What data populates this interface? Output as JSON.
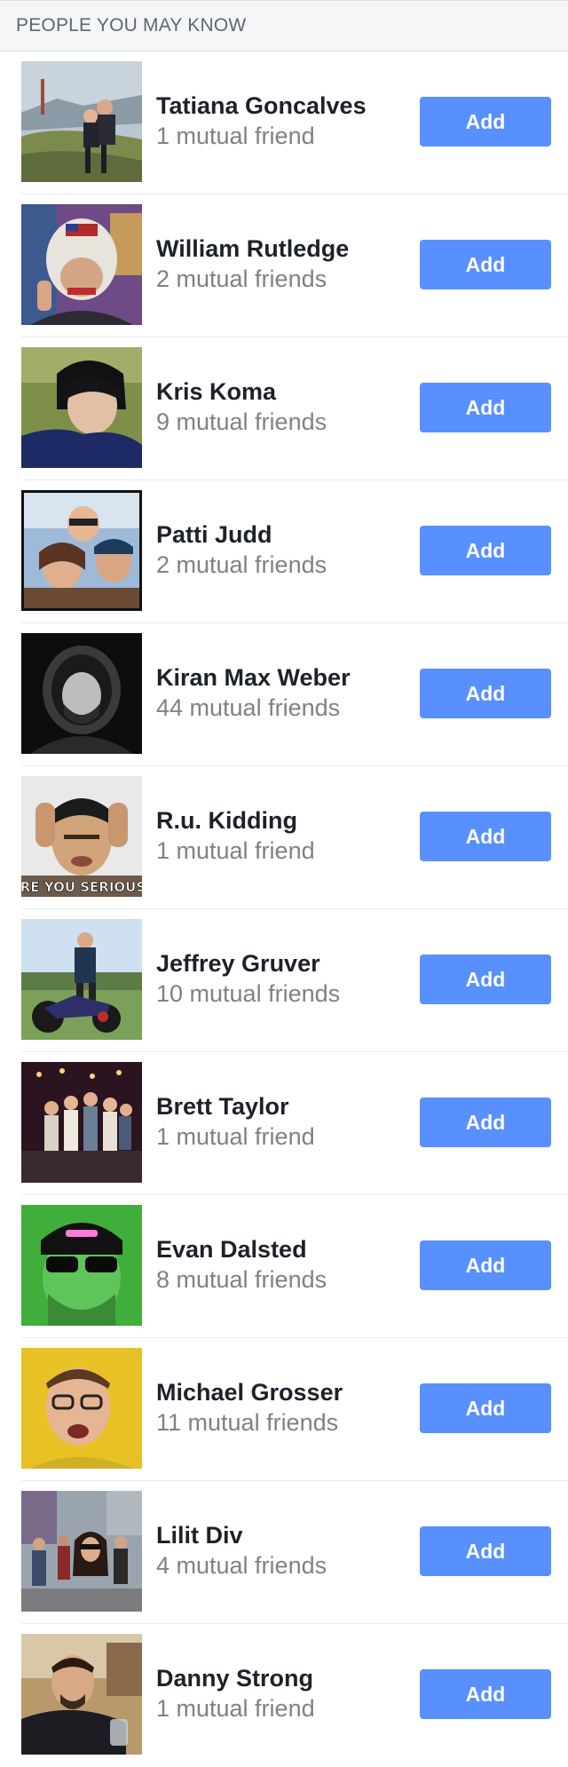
{
  "header": {
    "title": "PEOPLE YOU MAY KNOW"
  },
  "people": [
    {
      "name": "Tatiana Goncalves",
      "mutual": "1 mutual friend",
      "add_label": "Add"
    },
    {
      "name": "William Rutledge",
      "mutual": "2 mutual friends",
      "add_label": "Add"
    },
    {
      "name": "Kris Koma",
      "mutual": "9 mutual friends",
      "add_label": "Add"
    },
    {
      "name": "Patti Judd",
      "mutual": "2 mutual friends",
      "add_label": "Add"
    },
    {
      "name": "Kiran Max Weber",
      "mutual": "44 mutual friends",
      "add_label": "Add"
    },
    {
      "name": "R.u. Kidding",
      "mutual": "1 mutual friend",
      "add_label": "Add",
      "photo_caption": "ARE YOU SERIOUS?"
    },
    {
      "name": "Jeffrey Gruver",
      "mutual": "10 mutual friends",
      "add_label": "Add"
    },
    {
      "name": "Brett Taylor",
      "mutual": "1 mutual friend",
      "add_label": "Add"
    },
    {
      "name": "Evan Dalsted",
      "mutual": "8 mutual friends",
      "add_label": "Add"
    },
    {
      "name": "Michael Grosser",
      "mutual": "11 mutual friends",
      "add_label": "Add"
    },
    {
      "name": "Lilit Div",
      "mutual": "4 mutual friends",
      "add_label": "Add"
    },
    {
      "name": "Danny Strong",
      "mutual": "1 mutual friend",
      "add_label": "Add"
    }
  ],
  "colors": {
    "button_blue": "#5890ff",
    "name_text": "#1d2129",
    "secondary_text": "#7f8187",
    "header_bg": "#f5f6f7"
  }
}
